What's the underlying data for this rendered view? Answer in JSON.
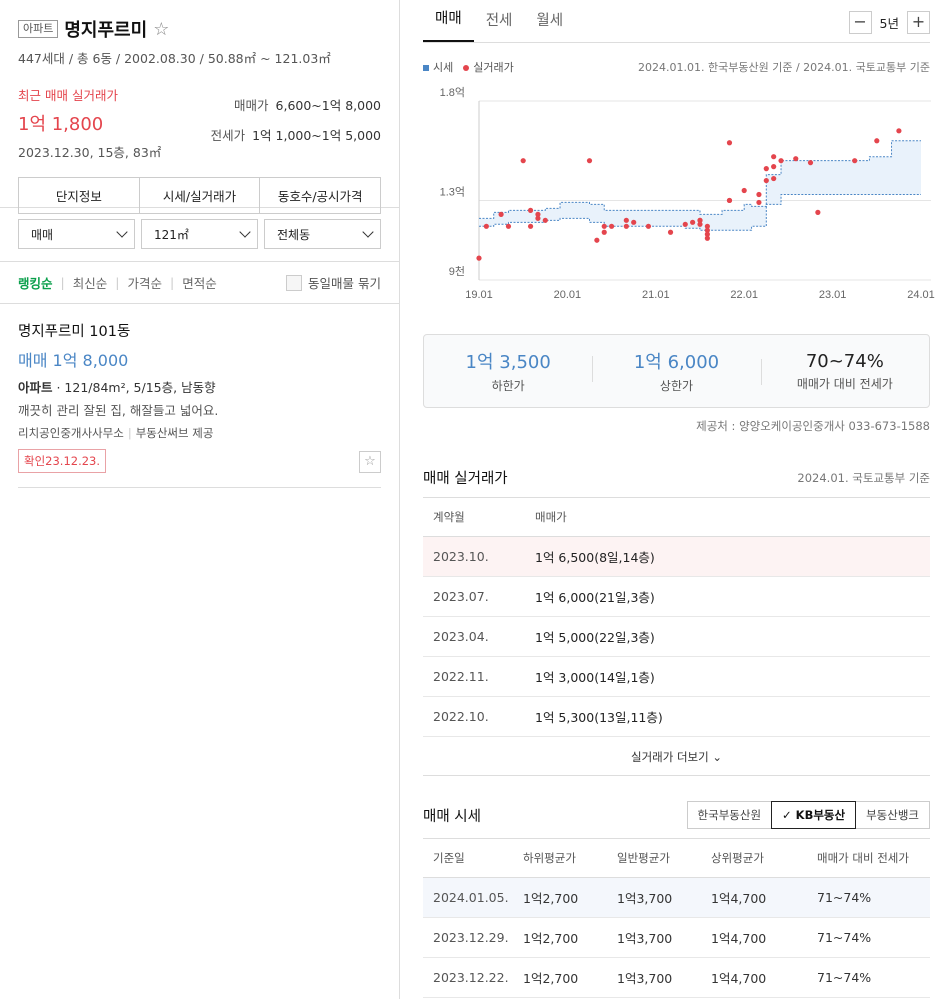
{
  "summary": {
    "type_badge": "아파트",
    "name": "명지푸르미",
    "info": "447세대 / 총 6동 / 2002.08.30 / 50.88㎡ ~ 121.03㎡",
    "recent_label": "최근 매매 실거래가",
    "recent_price": "1억 1,800",
    "recent_sub": "2023.12.30, 15층, 83㎡",
    "sale_label": "매매가",
    "sale_range": "6,600~1억 8,000",
    "jeonse_label": "전세가",
    "jeonse_range": "1억 1,000~1억 5,000",
    "tabs": [
      "단지정보",
      "시세/실거래가",
      "동호수/공시가격"
    ]
  },
  "filters": {
    "trade_type": "매매",
    "area": "121㎡",
    "dong": "전체동"
  },
  "sort": {
    "items": [
      "랭킹순",
      "최신순",
      "가격순",
      "면적순"
    ],
    "group_label": "동일매물 묶기"
  },
  "listing": {
    "name": "명지푸르미 101동",
    "price": "매매 1억 8,000",
    "spec_type": "아파트",
    "spec": " · 121/84m², 5/15층, 남동향",
    "desc": "깨끗히 관리 잘된 집, 해잘들고 넓어요.",
    "agent": "리치공인중개사사무소",
    "source": "부동산써브 제공",
    "confirm": "확인23.12.23."
  },
  "right": {
    "tabs": [
      "매매",
      "전세",
      "월세"
    ],
    "period": "5년",
    "minus": "−",
    "plus": "+",
    "legend_price": "시세",
    "legend_actual": "실거래가",
    "legend_ref": "2024.01.01. 한국부동산원 기준 / 2024.01. 국토교통부 기준",
    "stats": [
      {
        "value": "1억 3,500",
        "label": "하한가"
      },
      {
        "value": "1억 6,000",
        "label": "상한가"
      },
      {
        "value": "70~74%",
        "label": "매매가 대비 전세가"
      }
    ],
    "provider": "제공처 : 양양오케이공인중개사 033-673-1588",
    "actual": {
      "title": "매매 실거래가",
      "ref": "2024.01. 국토교통부 기준",
      "headers": [
        "계약월",
        "매매가"
      ],
      "rows": [
        [
          "2023.10.",
          "1억 6,500(8일,14층)"
        ],
        [
          "2023.07.",
          "1억 6,000(21일,3층)"
        ],
        [
          "2023.04.",
          "1억 5,000(22일,3층)"
        ],
        [
          "2022.11.",
          "1억 3,000(14일,1층)"
        ],
        [
          "2022.10.",
          "1억 5,300(13일,11층)"
        ]
      ],
      "more": "실거래가 더보기 ⌄"
    },
    "market": {
      "title": "매매 시세",
      "sources": [
        "한국부동산원",
        "✓ KB부동산",
        "부동산뱅크"
      ],
      "headers": [
        "기준일",
        "하위평균가",
        "일반평균가",
        "상위평균가",
        "매매가 대비 전세가"
      ],
      "rows": [
        [
          "2024.01.05.",
          "1억2,700",
          "1억3,700",
          "1억4,700",
          "71~74%"
        ],
        [
          "2023.12.29.",
          "1억2,700",
          "1억3,700",
          "1억4,700",
          "71~74%"
        ],
        [
          "2023.12.22.",
          "1억2,700",
          "1억3,700",
          "1억4,700",
          "71~74%"
        ]
      ]
    }
  },
  "chart_data": {
    "type": "scatter",
    "title": "",
    "xlabel": "",
    "ylabel": "",
    "x_ticks": [
      "19.01",
      "20.01",
      "21.01",
      "22.01",
      "23.01",
      "24.01"
    ],
    "y_ticks": [
      {
        "value": 9000,
        "label": "9천"
      },
      {
        "value": 13000,
        "label": "1.3억"
      },
      {
        "value": 18000,
        "label": "1.8억"
      }
    ],
    "ylim": [
      9000,
      18000
    ],
    "xlim": [
      "2019-01",
      "2024-01"
    ],
    "colors": {
      "band": "#4a86c5",
      "band_fill": "#e9f2fb",
      "dots": "#e4454d"
    },
    "band": {
      "name": "시세",
      "x": [
        "2019-01",
        "2019-03",
        "2019-05",
        "2019-10",
        "2019-12",
        "2020-02",
        "2020-04",
        "2020-06",
        "2020-09",
        "2021-05",
        "2021-07",
        "2021-10",
        "2022-01",
        "2022-02",
        "2022-04",
        "2022-06",
        "2022-09",
        "2023-01",
        "2023-06",
        "2023-09",
        "2024-01"
      ],
      "upper": [
        12100,
        12400,
        12500,
        12600,
        12900,
        12900,
        12800,
        12500,
        12500,
        12500,
        12300,
        12500,
        12800,
        12700,
        14300,
        15000,
        15000,
        15000,
        15200,
        16000,
        16000
      ],
      "lower": [
        11700,
        11800,
        11900,
        12000,
        12100,
        12100,
        11900,
        11700,
        11700,
        11600,
        11500,
        11500,
        11500,
        11700,
        12800,
        13300,
        13300,
        13300,
        13300,
        13300,
        13300
      ]
    },
    "points": {
      "name": "실거래가",
      "x": [
        "2019-01",
        "2019-02",
        "2019-04",
        "2019-05",
        "2019-07",
        "2019-08",
        "2019-08",
        "2019-09",
        "2019-09",
        "2019-10",
        "2020-04",
        "2020-05",
        "2020-06",
        "2020-06",
        "2020-07",
        "2020-09",
        "2020-09",
        "2020-10",
        "2020-12",
        "2021-03",
        "2021-05",
        "2021-06",
        "2021-07",
        "2021-07",
        "2021-07",
        "2021-08",
        "2021-08",
        "2021-08",
        "2021-08",
        "2021-11",
        "2021-11",
        "2021-11",
        "2022-01",
        "2022-03",
        "2022-03",
        "2022-04",
        "2022-04",
        "2022-05",
        "2022-05",
        "2022-05",
        "2022-06",
        "2022-08",
        "2022-10",
        "2022-11",
        "2023-04",
        "2023-07",
        "2023-10"
      ],
      "y": [
        10100,
        11700,
        12300,
        11700,
        15000,
        12500,
        11700,
        12100,
        12300,
        12000,
        15000,
        11000,
        11400,
        11700,
        11700,
        12000,
        11700,
        11900,
        11700,
        11400,
        11800,
        11900,
        12000,
        12000,
        11800,
        11700,
        11500,
        11300,
        11100,
        15900,
        13000,
        13000,
        13500,
        13300,
        12900,
        14600,
        14000,
        14100,
        15200,
        14700,
        15000,
        15100,
        14900,
        12400,
        15000,
        16000,
        16500
      ]
    }
  }
}
